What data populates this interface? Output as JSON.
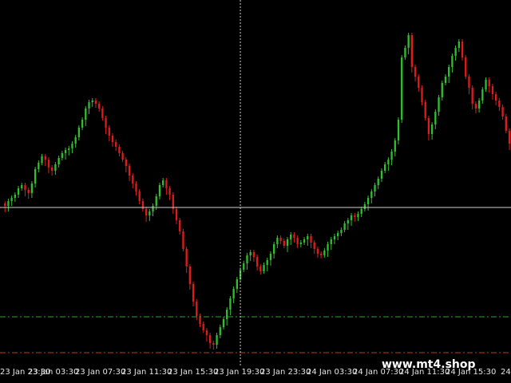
{
  "colors": {
    "background": "#000000",
    "bull": "#2fbf2f",
    "bear": "#e01b1b",
    "crosshair": "#cfcfcf",
    "green_level": "#2aa52a",
    "red_level": "#c23a2a",
    "text": "#ffffff"
  },
  "watermark": "www.mt4.shop",
  "axis": {
    "labels": [
      "23 Jan 23:30",
      "23 Jan 03:30",
      "23 Jan 07:30",
      "23 Jan 11:30",
      "23 Jan 15:30",
      "23 Jan 19:30",
      "23 Jan 23:30",
      "24 Jan 03:30",
      "24 Jan 07:30",
      "24 Jan 11:30",
      "24 Jan 15:30",
      "24 Jan"
    ]
  },
  "chart_data": {
    "type": "candlestick",
    "series": "close",
    "close_levels": [
      255,
      258,
      252,
      248,
      244,
      236,
      232,
      238,
      242,
      230,
      212,
      204,
      196,
      200,
      210,
      214,
      206,
      198,
      192,
      188,
      186,
      180,
      172,
      160,
      150,
      136,
      128,
      126,
      130,
      136,
      148,
      160,
      170,
      178,
      184,
      192,
      200,
      208,
      220,
      230,
      240,
      252,
      262,
      270,
      265,
      258,
      246,
      232,
      226,
      236,
      244,
      262,
      276,
      290,
      312,
      334,
      356,
      378,
      396,
      406,
      414,
      420,
      430,
      432,
      420,
      410,
      400,
      388,
      374,
      362,
      350,
      338,
      330,
      320,
      316,
      322,
      334,
      340,
      332,
      326,
      318,
      306,
      298,
      302,
      308,
      300,
      294,
      298,
      306,
      304,
      300,
      296,
      304,
      312,
      318,
      320,
      314,
      306,
      300,
      296,
      292,
      288,
      280,
      276,
      270,
      272,
      268,
      262,
      256,
      248,
      240,
      232,
      224,
      214,
      206,
      200,
      190,
      176,
      150,
      72,
      60,
      44,
      84,
      96,
      110,
      128,
      148,
      168,
      156,
      140,
      122,
      104,
      96,
      84,
      70,
      60,
      52,
      72,
      96,
      110,
      130,
      136,
      126,
      112,
      100,
      108,
      118,
      126,
      134,
      146,
      164,
      180
    ],
    "y_scale": "inverted_price_pixels",
    "annotations": {
      "crosshair_horizontal_level": 260,
      "crosshair_vertical_x_index": 71,
      "green_dash_level": 397,
      "red_dash_level": 442
    }
  }
}
